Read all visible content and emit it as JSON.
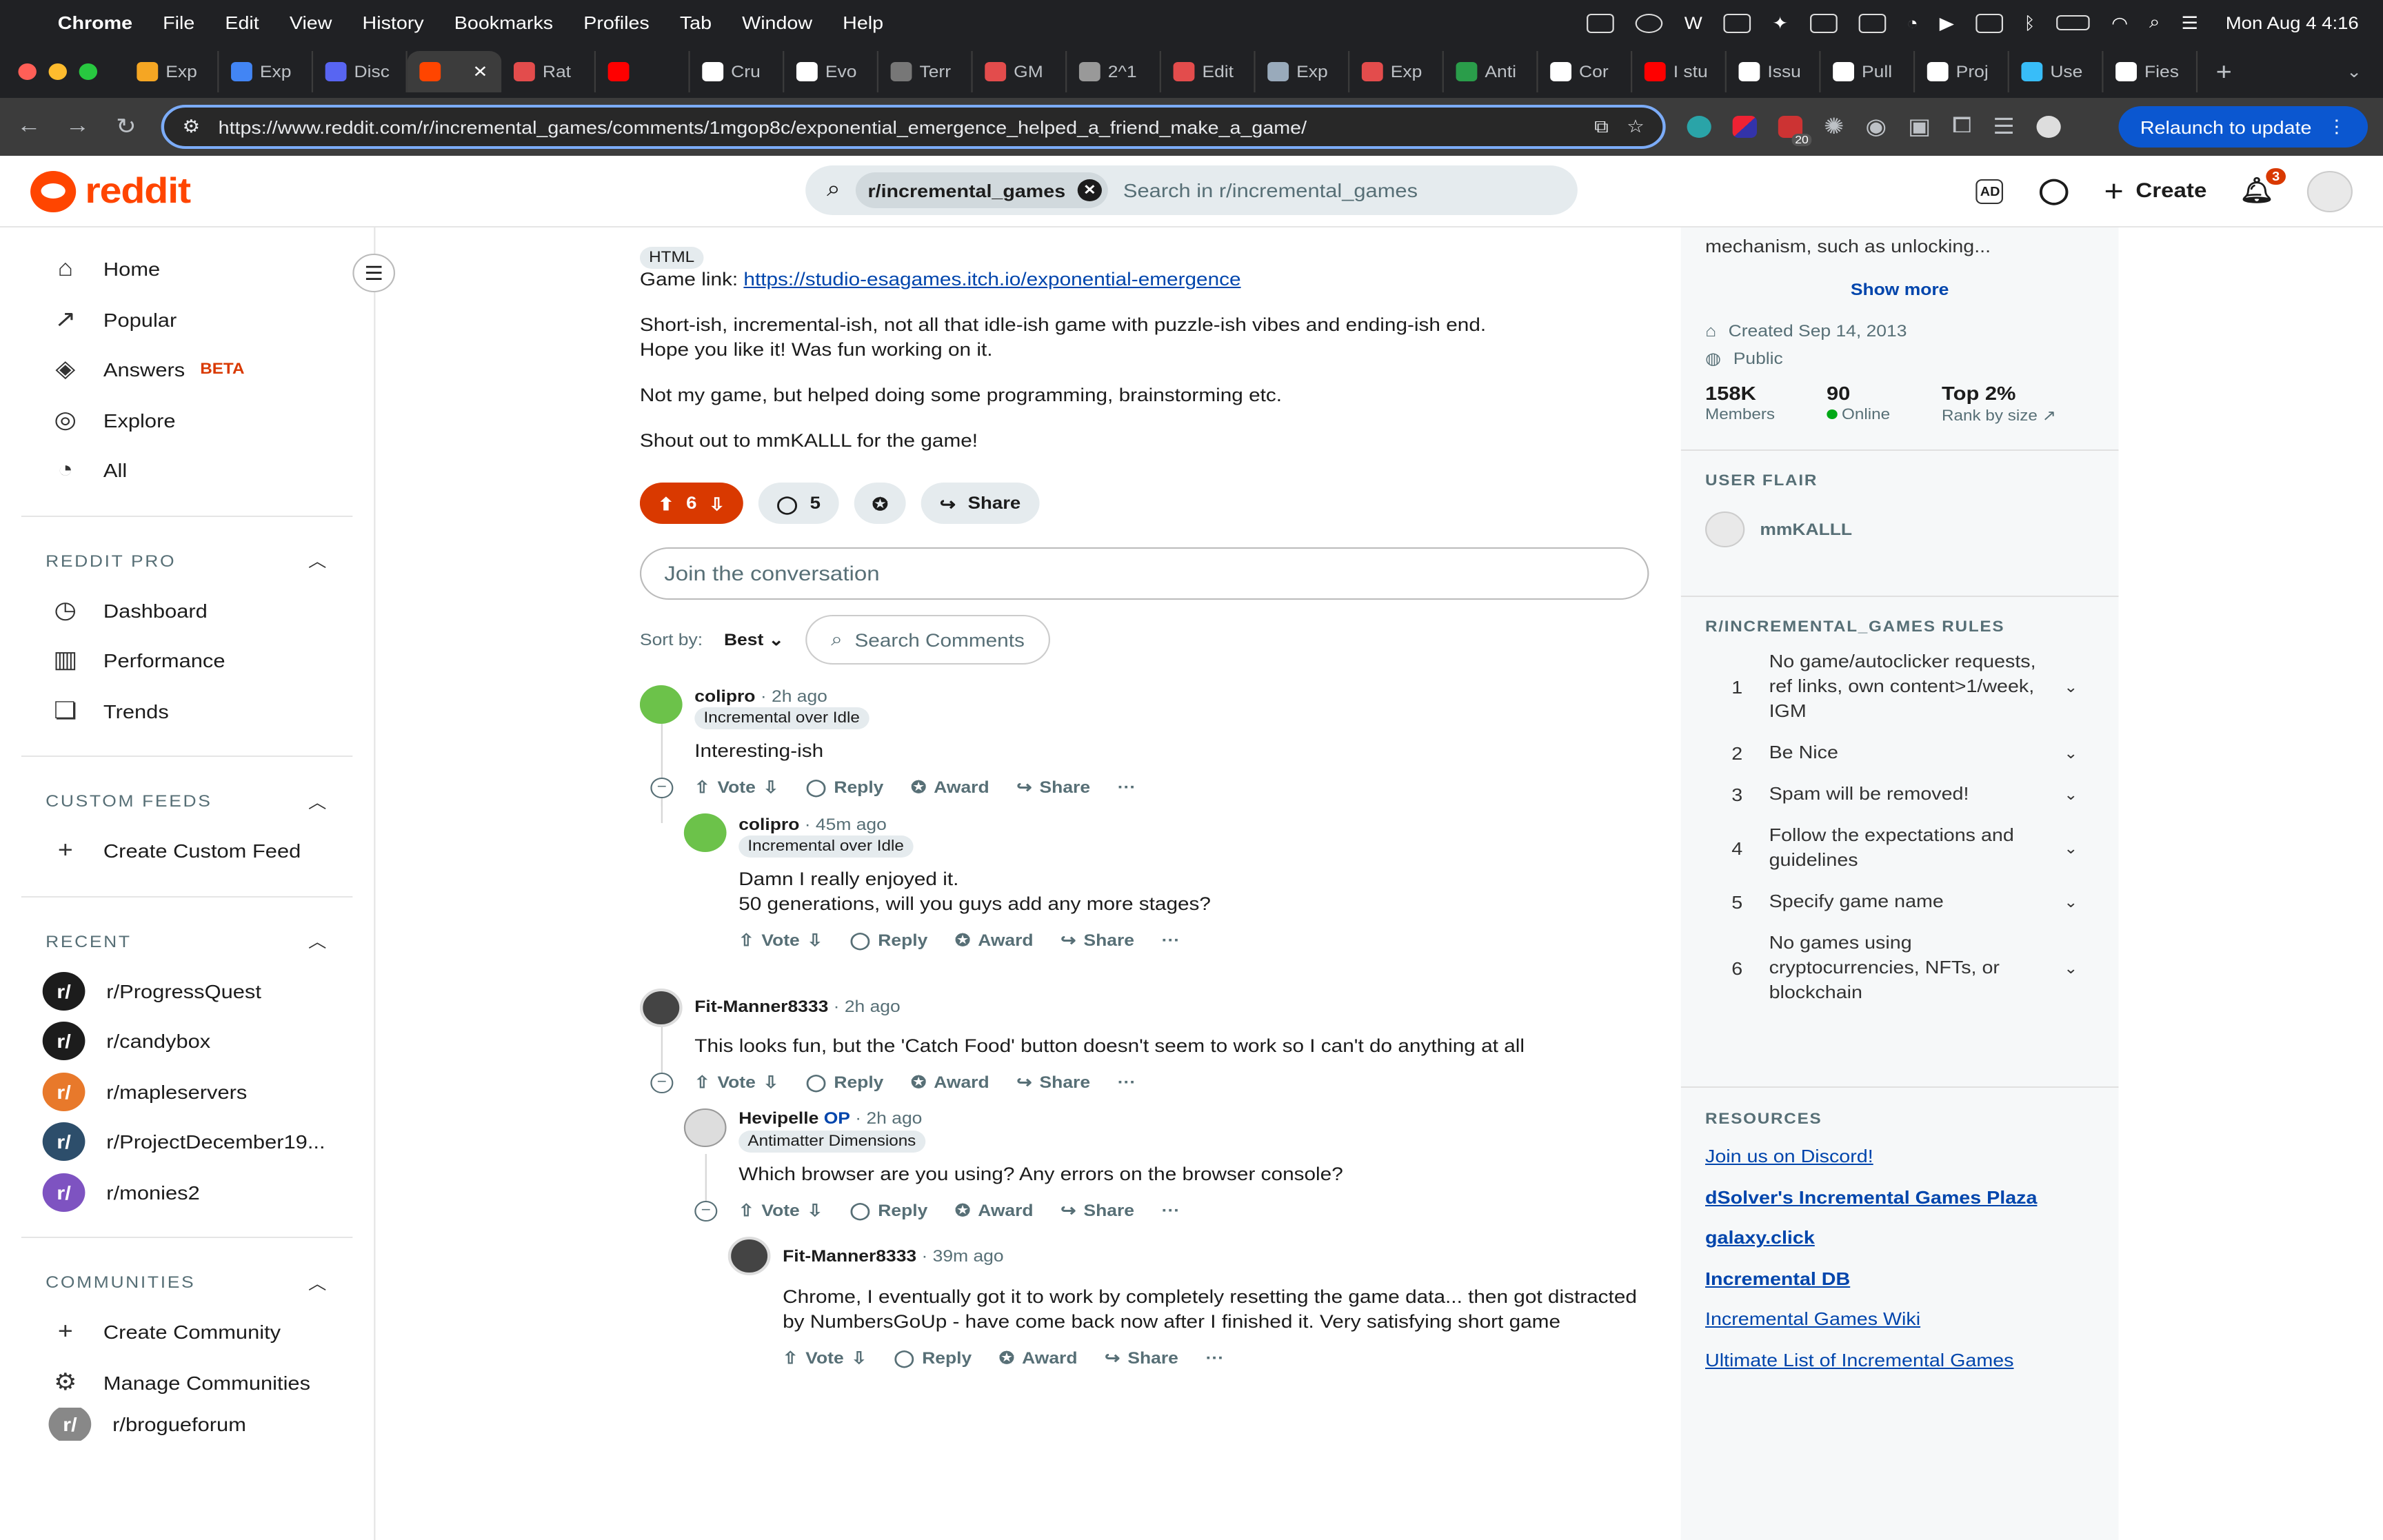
{
  "menubar": {
    "app": "Chrome",
    "items": [
      "File",
      "Edit",
      "View",
      "History",
      "Bookmarks",
      "Profiles",
      "Tab",
      "Window",
      "Help"
    ],
    "datetime": "Mon Aug 4  4:16"
  },
  "tabs": [
    {
      "label": "Exp",
      "color": "#f5a623"
    },
    {
      "label": "Exp",
      "color": "#4285f4"
    },
    {
      "label": "Disc",
      "color": "#5865f2"
    },
    {
      "label": "",
      "color": "#ff4500"
    },
    {
      "label": "Rat",
      "color": "#e34c4c"
    },
    {
      "label": "",
      "color": "#ff0000"
    },
    {
      "label": "Cru",
      "color": "#ffffff"
    },
    {
      "label": "Evo",
      "color": "#ffffff"
    },
    {
      "label": "Terr",
      "color": "#777777"
    },
    {
      "label": "GM",
      "color": "#e34c4c"
    },
    {
      "label": "2^1",
      "color": "#999999"
    },
    {
      "label": "Edit",
      "color": "#e34c4c"
    },
    {
      "label": "Exp",
      "color": "#9ab"
    },
    {
      "label": "Exp",
      "color": "#e34c4c"
    },
    {
      "label": "Anti",
      "color": "#2a9d4a"
    },
    {
      "label": "Cor",
      "color": "#ffffff"
    },
    {
      "label": "I stu",
      "color": "#ff0000"
    },
    {
      "label": "Issu",
      "color": "#ffffff"
    },
    {
      "label": "Pull",
      "color": "#ffffff"
    },
    {
      "label": "Proj",
      "color": "#ffffff"
    },
    {
      "label": "Use",
      "color": "#38bdf8"
    },
    {
      "label": "Fies",
      "color": "#ffffff"
    }
  ],
  "browser": {
    "url": "https://www.reddit.com/r/incremental_games/comments/1mgop8c/exponential_emergence_helped_a_friend_make_a_game/",
    "relaunch": "Relaunch to update",
    "ext_badge": "20"
  },
  "reddit": {
    "logo": "reddit",
    "search_chip": "r/incremental_games",
    "search_placeholder": "Search in r/incremental_games",
    "create": "Create",
    "notif_count": "3"
  },
  "sidebar": {
    "main": [
      {
        "label": "Home",
        "icon": "⌂"
      },
      {
        "label": "Popular",
        "icon": "↗"
      },
      {
        "label": "Answers",
        "icon": "◈",
        "beta": "BETA"
      },
      {
        "label": "Explore",
        "icon": "◎"
      },
      {
        "label": "All",
        "icon": "◔"
      }
    ],
    "reddit_pro": {
      "title": "REDDIT PRO",
      "items": [
        {
          "label": "Dashboard",
          "icon": "◷"
        },
        {
          "label": "Performance",
          "icon": "▥"
        },
        {
          "label": "Trends",
          "icon": "❏"
        }
      ]
    },
    "custom_feeds": {
      "title": "CUSTOM FEEDS",
      "create": "Create Custom Feed"
    },
    "recent": {
      "title": "RECENT",
      "items": [
        {
          "label": "r/ProgressQuest",
          "color": "#1c1c1c"
        },
        {
          "label": "r/candybox",
          "color": "#1c1c1c"
        },
        {
          "label": "r/mapleservers",
          "color": "#e8792b"
        },
        {
          "label": "r/ProjectDecember19...",
          "color": "#2d4e6b"
        },
        {
          "label": "r/monies2",
          "color": "#7e53c1"
        }
      ]
    },
    "communities": {
      "title": "COMMUNITIES",
      "create": "Create Community",
      "manage": "Manage Communities",
      "partial": "r/brogueforum"
    }
  },
  "post": {
    "flair": "HTML",
    "game_link_label": "Game link: ",
    "game_link": "https://studio-esagames.itch.io/exponential-emergence",
    "para1": "Short-ish, incremental-ish, not all that idle-ish game with puzzle-ish vibes and ending-ish end.",
    "para2": "Hope you like it! Was fun working on it.",
    "para3": "Not my game, but helped doing some programming, brainstorming etc.",
    "para4": "Shout out to mmKALLL for the game!",
    "votes": "6",
    "comments": "5",
    "share": "Share",
    "join": "Join the conversation",
    "sort_label": "Sort by:",
    "sort_value": "Best",
    "search_comments": "Search Comments"
  },
  "actions": {
    "vote": "Vote",
    "reply": "Reply",
    "award": "Award",
    "share": "Share",
    "more": "···"
  },
  "comments": [
    {
      "user": "colipro",
      "time": "2h ago",
      "flair": "Incremental over Idle",
      "text": "Interesting-ish",
      "avatar": "#6cc24a"
    },
    {
      "user": "colipro",
      "time": "45m ago",
      "flair": "Incremental over Idle",
      "text1": "Damn I really enjoyed it.",
      "text2": "50 generations, will you guys add any more stages?",
      "avatar": "#6cc24a"
    },
    {
      "user": "Fit-Manner8333",
      "time": "2h ago",
      "text": "This looks fun, but the 'Catch Food' button doesn't seem to work so I can't do anything at all",
      "avatar": "#444"
    },
    {
      "user": "Hevipelle",
      "op": "OP",
      "time": "2h ago",
      "flair": "Antimatter Dimensions",
      "text": "Which browser are you using? Any errors on the browser console?",
      "avatar": "#ddd"
    },
    {
      "user": "Fit-Manner8333",
      "time": "39m ago",
      "text1": "Chrome, I eventually got it to work by completely resetting the game data... then got distracted",
      "text2": "by NumbersGoUp - have come back now after I finished it. Very satisfying short game",
      "avatar": "#444"
    }
  ],
  "right": {
    "desc_tail": "mechanism, such as unlocking...",
    "show_more": "Show more",
    "created": "Created Sep 14, 2013",
    "visibility": "Public",
    "members": "158K",
    "members_label": "Members",
    "online": "90",
    "online_label": "Online",
    "rank": "Top 2%",
    "rank_label": "Rank by size",
    "user_flair_title": "USER FLAIR",
    "user_flair_name": "mmKALLL",
    "rules_title": "R/INCREMENTAL_GAMES RULES",
    "rules": [
      {
        "n": "1",
        "t": "No game/autoclicker requests, ref links, own content>1/week, IGM"
      },
      {
        "n": "2",
        "t": "Be Nice"
      },
      {
        "n": "3",
        "t": "Spam will be removed!"
      },
      {
        "n": "4",
        "t": "Follow the expectations and guidelines"
      },
      {
        "n": "5",
        "t": "Specify game name"
      },
      {
        "n": "6",
        "t": "No games using cryptocurrencies, NFTs, or blockchain"
      }
    ],
    "resources_title": "RESOURCES",
    "resources": [
      {
        "label": "Join us on Discord!",
        "bold": false
      },
      {
        "label": "dSolver's Incremental Games Plaza",
        "bold": true
      },
      {
        "label": "galaxy.click",
        "bold": true
      },
      {
        "label": "Incremental DB",
        "bold": true
      },
      {
        "label": "Incremental Games Wiki",
        "bold": false
      },
      {
        "label": "Ultimate List of Incremental Games",
        "bold": false
      }
    ]
  }
}
